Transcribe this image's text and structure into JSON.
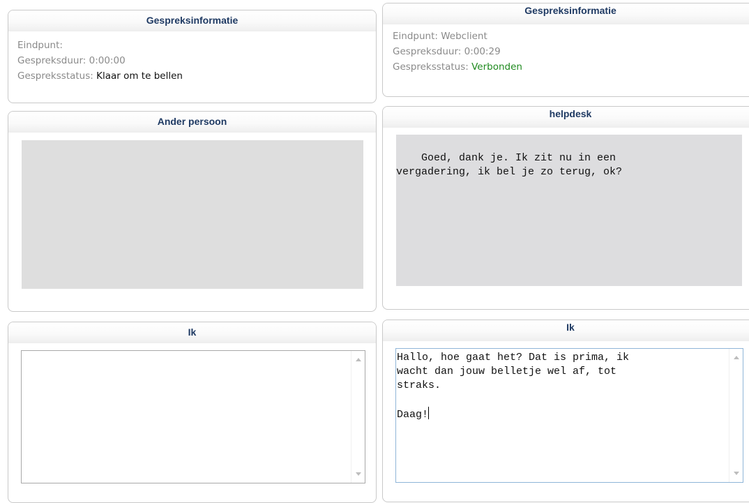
{
  "left": {
    "info_panel": {
      "title": "Gespreksinformatie",
      "endpoint_label": "Eindpunt:",
      "endpoint_value": "",
      "duration_label": "Gespreksduur: 0:00:00",
      "status_label": "Gespreksstatus:",
      "status_value": "Klaar om te bellen"
    },
    "remote_panel": {
      "title": "Ander persoon"
    },
    "me_panel": {
      "title": "Ik",
      "message_text": ""
    }
  },
  "right": {
    "info_panel": {
      "title": "Gespreksinformatie",
      "endpoint_label": "Eindpunt: Webclient",
      "duration_label": "Gespreksduur: 0:00:29",
      "status_label": "Gespreksstatus:",
      "status_value": "Verbonden"
    },
    "remote_panel": {
      "title": "helpdesk",
      "message_text": "Goed, dank je. Ik zit nu in een\nvergadering, ik bel je zo terug, ok?"
    },
    "me_panel": {
      "title": "Ik",
      "message_text": "Hallo, hoe gaat het? Dat is prima, ik\nwacht dan jouw belletje wel af, tot\nstraks.\n\nDaag!"
    }
  },
  "colors": {
    "header_text": "#1f3a63",
    "status_connected": "#1f8a1f",
    "message_background": "#dddddf"
  },
  "icons": {
    "scroll_up": "scroll-up-arrow-icon",
    "scroll_down": "scroll-down-arrow-icon"
  }
}
